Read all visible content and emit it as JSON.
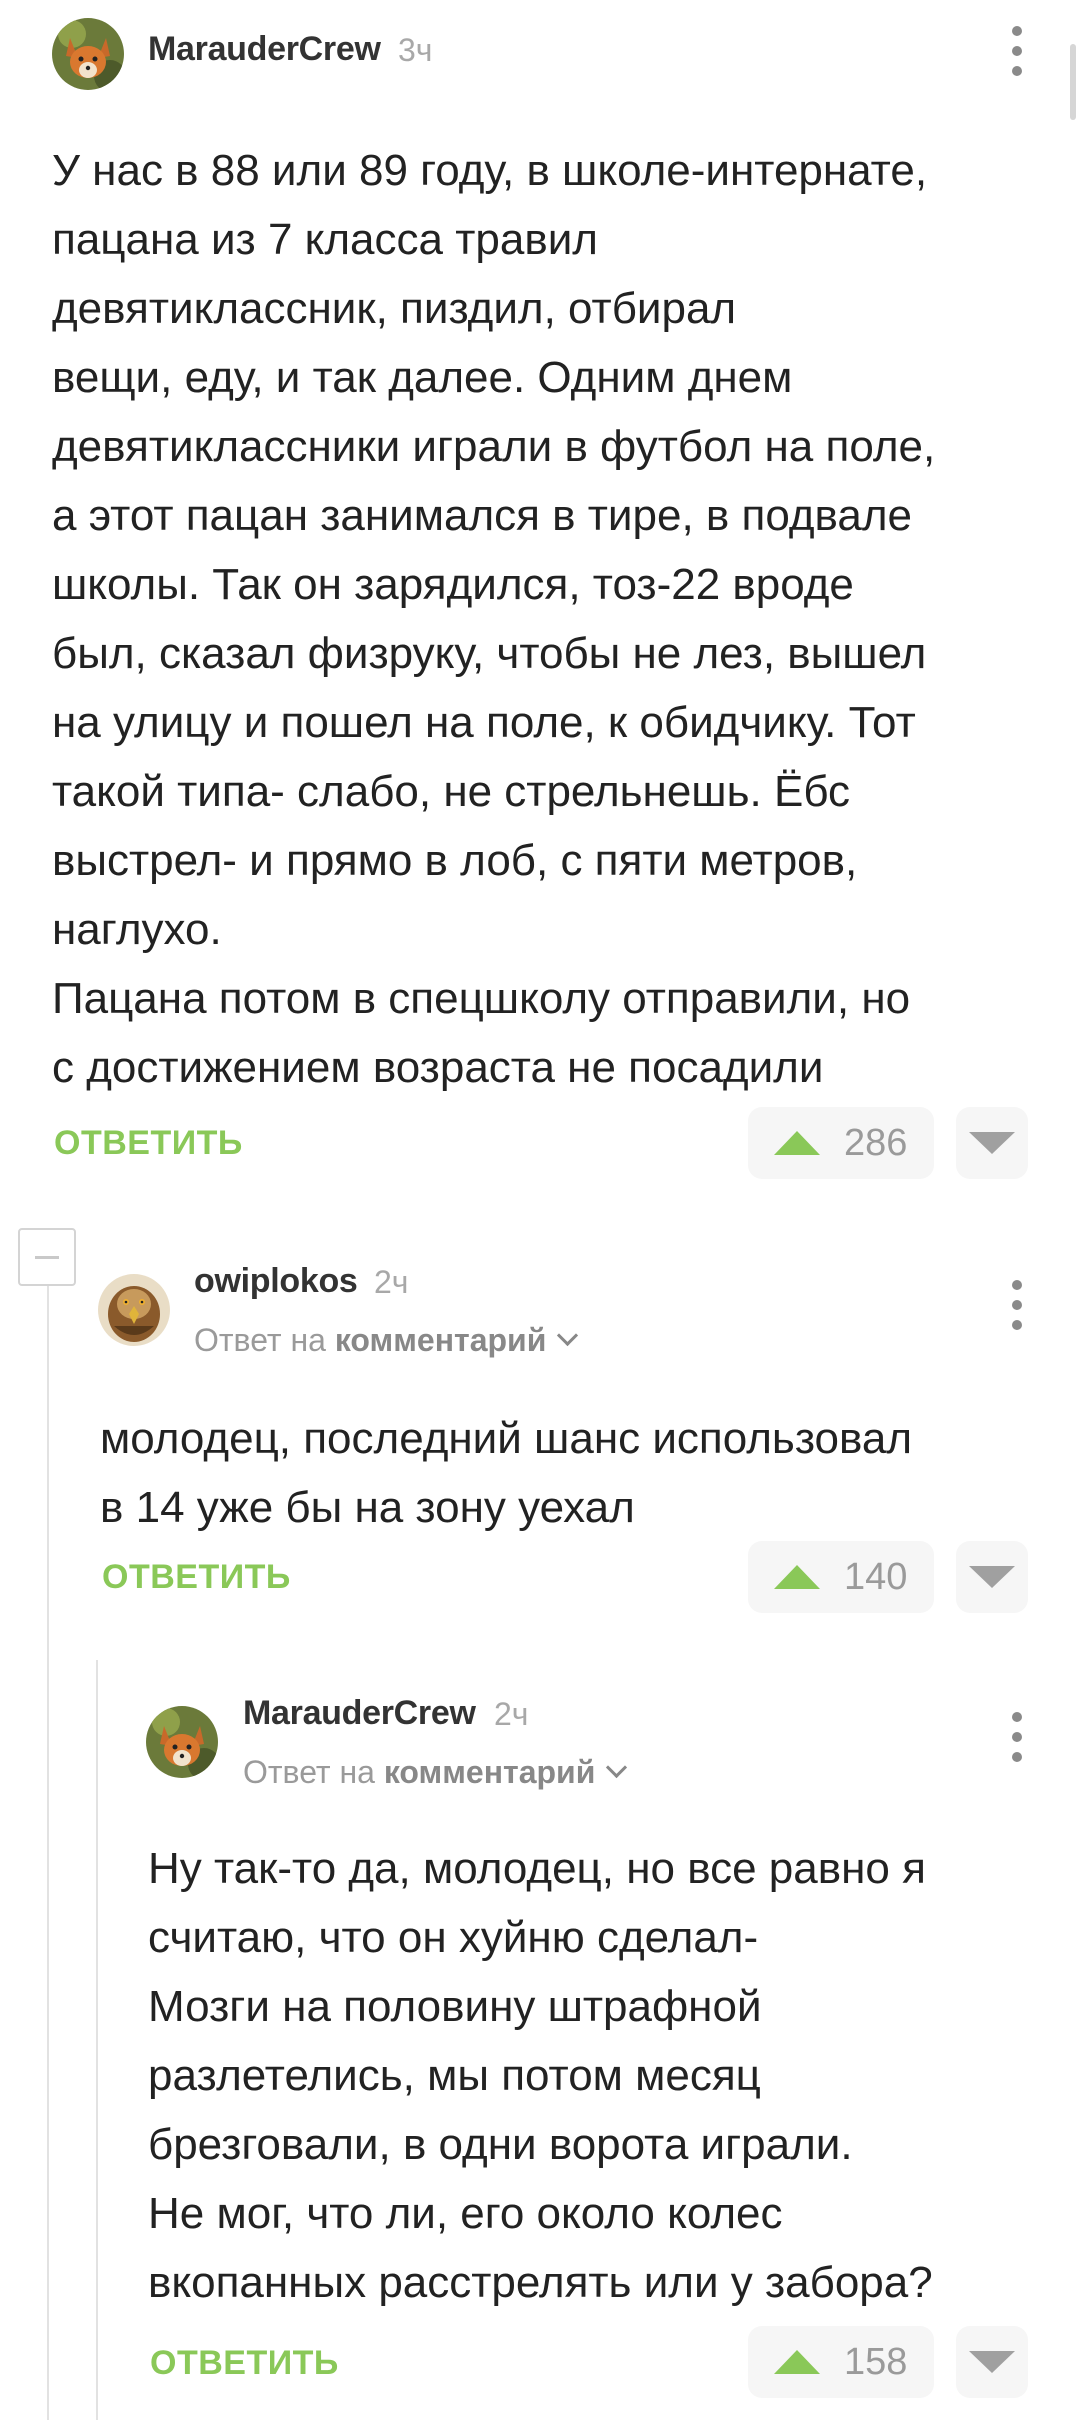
{
  "comments": [
    {
      "author": "MarauderCrew",
      "time": "3ч",
      "avatar_icon": "fox-avatar-icon",
      "body_lines": [
        "У нас в 88 или 89 году, в школе-интернате,",
        "пацана из 7 класса травил",
        "девятиклассник, пиздил, отбирал",
        "вещи, еду, и так далее. Одним днем",
        "девятиклассники играли в футбол на поле,",
        "а этот пацан занимался в тире, в подвале",
        "школы. Так он зарядился, тоз-22 вроде",
        "был, сказал физруку, чтобы не лез, вышел",
        "на улицу и пошел на поле, к обидчику. Тот",
        "такой типа- слабо, не стрельнешь. Ёбс",
        "выстрел- и прямо в лоб, с пяти метров,",
        "наглухо.",
        "Пацана потом в спецшколу отправили, но",
        "с достижением возраста не посадили"
      ],
      "reply_label": "ОТВЕТИТЬ",
      "rating": "286"
    },
    {
      "author": "owiplokos",
      "time": "2ч",
      "avatar_icon": "eagle-avatar-icon",
      "reply_to_prefix": "Ответ на",
      "reply_to_target": "комментарий",
      "body_lines": [
        "молодец, последний шанс использовал",
        "в 14 уже бы на зону уехал"
      ],
      "reply_label": "ОТВЕТИТЬ",
      "rating": "140"
    },
    {
      "author": "MarauderCrew",
      "time": "2ч",
      "avatar_icon": "fox-avatar-icon",
      "reply_to_prefix": "Ответ на",
      "reply_to_target": "комментарий",
      "body_lines": [
        "Ну так-то да, молодец, но все равно я",
        "считаю, что он хуйню сделал-",
        "Мозги на половину штрафной",
        "разлетелись, мы потом месяц",
        "брезговали, в одни ворота играли.",
        "Не мог, что ли, его около колес",
        "вкопанных расстрелять или у забора?"
      ],
      "reply_label": "ОТВЕТИТЬ",
      "rating": "158"
    }
  ],
  "colors": {
    "accent_green": "#8ac858",
    "text": "#222222",
    "muted": "#a8a8a8"
  }
}
